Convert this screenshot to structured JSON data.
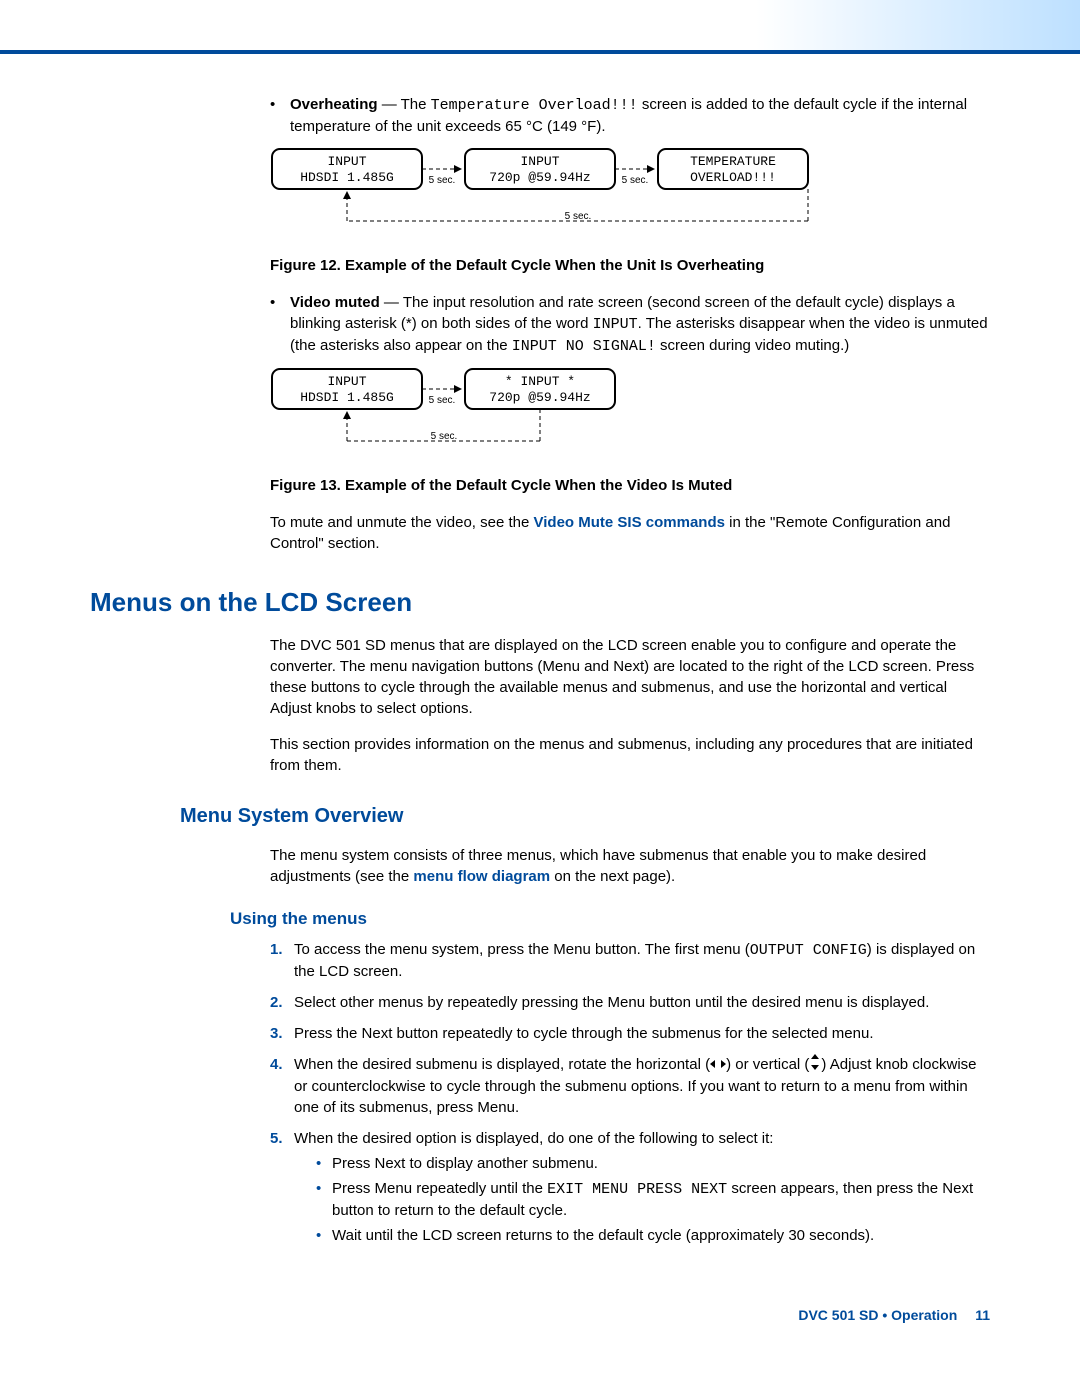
{
  "bullets": {
    "overheat": {
      "lead": "Overheating",
      "t1": " — The ",
      "code1": "Temperature Overload!!!",
      "t2": " screen is added to the default cycle if the internal temperature of the unit exceeds 65 °C (149 °F)."
    },
    "muted": {
      "lead": "Video muted",
      "t1": " — The input resolution and rate screen (second screen of the default cycle) displays a blinking asterisk (*) on both sides of the word ",
      "code1": "INPUT",
      "t2": ". The asterisks disappear when the video is unmuted (the asterisks also appear on the ",
      "code2": "INPUT NO SIGNAL!",
      "t3": " screen during video muting.)"
    }
  },
  "fig12": {
    "caption": "Figure 12.  Example of the Default Cycle When the Unit Is Overheating",
    "box1l1": "INPUT",
    "box1l2": "HDSDI 1.485G",
    "box2l1": "INPUT",
    "box2l2": "720p @59.94Hz",
    "box3l1": "TEMPERATURE",
    "box3l2": "OVERLOAD!!!",
    "lbl5s": "5 sec."
  },
  "fig13": {
    "caption": "Figure 13.  Example of the Default Cycle When the Video Is Muted",
    "box1l1": "INPUT",
    "box1l2": "HDSDI 1.485G",
    "box2l1": "*  INPUT  *",
    "box2l2": "720p @59.94Hz",
    "lbl5s": "5 sec."
  },
  "mute_para": {
    "t1": "To mute and unmute the video, see the ",
    "link": "Video Mute SIS commands",
    "t2": " in the \"Remote Configuration and Control\" section."
  },
  "h1": "Menus on the LCD Screen",
  "menus_p1": "The DVC 501 SD menus that are displayed on the LCD screen enable you to configure and operate the converter. The menu navigation buttons (Menu and Next) are located to the right of the LCD screen. Press these buttons to cycle through the available menus and submenus, and use the horizontal and vertical Adjust knobs to select options.",
  "menus_p2": "This section provides information on the menus and submenus, including any procedures that are initiated from them.",
  "h2": "Menu System Overview",
  "overview_p": {
    "t1": "The menu system consists of three menus, which have submenus that enable you to make desired adjustments (see the ",
    "link": "menu flow diagram",
    "t2": " on the next page)."
  },
  "h3": "Using the menus",
  "steps": {
    "s1a": "To access the menu system, press the Menu button. The first menu (",
    "s1code": "OUTPUT CONFIG",
    "s1b": ") is displayed on the LCD screen.",
    "s2": "Select other menus by repeatedly pressing the Menu button until the desired menu is displayed.",
    "s3": "Press the Next button repeatedly to cycle through the submenus for the selected menu.",
    "s4a": "When the desired submenu is displayed, rotate the horizontal (",
    "s4b": ") or vertical (",
    "s4c": ") Adjust knob clockwise or counterclockwise to cycle through the submenu options. If you want to return to a menu from within one of its submenus, press Menu.",
    "s5": "When the desired option is displayed, do one of the following to select it:",
    "s5b1": "Press Next to display another submenu.",
    "s5b2a": "Press Menu repeatedly until the ",
    "s5b2code": "EXIT MENU PRESS NEXT",
    "s5b2b": " screen appears, then press the Next button to return to the default cycle.",
    "s5b3": "Wait until the LCD screen returns to the default cycle (approximately 30 seconds)."
  },
  "footer": {
    "text": "DVC 501 SD • Operation",
    "page": "11"
  }
}
